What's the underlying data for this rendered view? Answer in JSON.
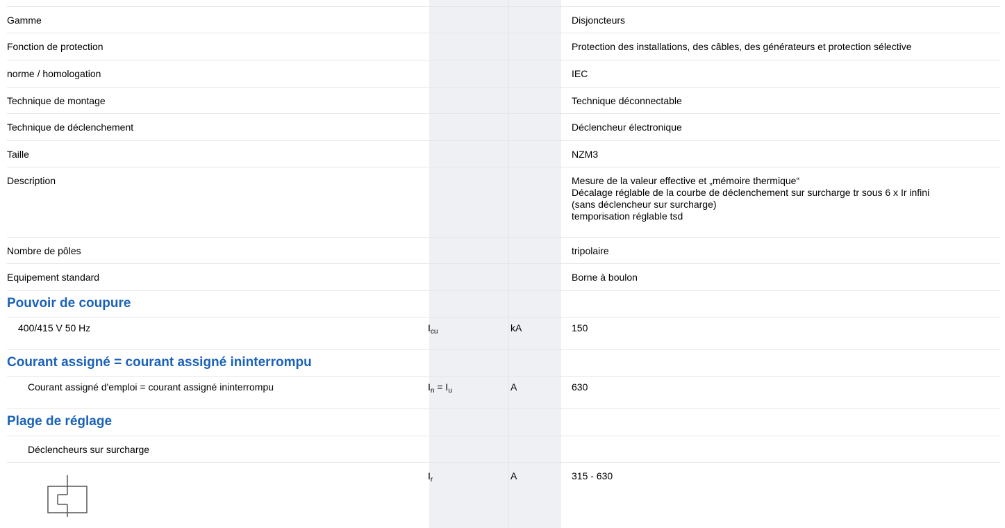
{
  "rows": [
    {
      "label": "Gamme",
      "value": "Disjoncteurs"
    },
    {
      "label": "Fonction de protection",
      "value": "Protection des installations, des câbles, des générateurs et protection sélective"
    },
    {
      "label": "norme / homologation",
      "value": "IEC"
    },
    {
      "label": "Technique de montage",
      "value": "Technique déconnectable"
    },
    {
      "label": "Technique de déclenchement",
      "value": "Déclencheur électronique"
    },
    {
      "label": "Taille",
      "value": "NZM3"
    },
    {
      "label": "Description",
      "value_lines": [
        "Mesure de la valeur effective et „mémoire thermique“",
        "Décalage réglable de la courbe de déclenchement sur surcharge tr sous 6 x Ir infini",
        "(sans déclencheur sur surcharge)",
        "temporisation réglable tsd"
      ]
    },
    {
      "label": "Nombre de pôles",
      "value": "tripolaire"
    },
    {
      "label": "Equipement standard",
      "value": "Borne à boulon"
    }
  ],
  "sections": {
    "pouvoir": {
      "title": "Pouvoir de coupure",
      "item": {
        "label": "400/415 V 50 Hz",
        "symbol": "I",
        "symbol_sub": "cu",
        "unit": "kA",
        "value": "150"
      }
    },
    "courant": {
      "title": "Courant assigné = courant assigné ininterrompu",
      "item": {
        "label": "Courant assigné d'emploi = courant assigné ininterrompu",
        "symbol_a": "I",
        "symbol_a_sub": "n",
        "symbol_eq": " = ",
        "symbol_b": "I",
        "symbol_b_sub": "u",
        "unit": "A",
        "value": "630"
      }
    },
    "plage": {
      "title": "Plage de réglage",
      "item": {
        "label": "Déclencheurs sur surcharge"
      },
      "symbol_row": {
        "icon": "overload-release-symbol-icon",
        "symbol": "I",
        "symbol_sub": "r",
        "unit": "A",
        "value": "315 - 630"
      }
    }
  }
}
